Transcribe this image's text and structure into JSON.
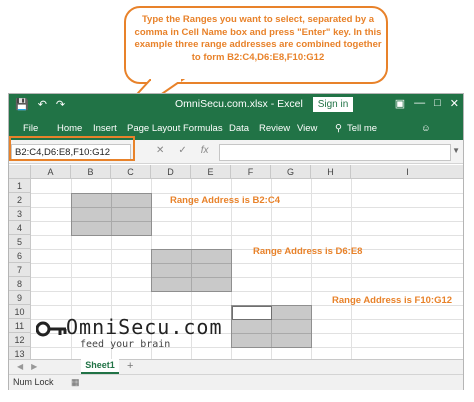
{
  "callout": {
    "text": "Type the Ranges you want to select, separated by a comma in Cell Name box and press \"Enter\" key. In this example three range addresses are combined together to form B2:C4,D6:E8,F10:G12"
  },
  "titlebar": {
    "title": "OmniSecu.com.xlsx - Excel",
    "sign_in": "Sign in",
    "save_icon": "save-icon",
    "undo_icon": "undo-icon",
    "redo_icon": "redo-icon",
    "restore_icon": "ribbon-display-icon",
    "minimize_icon": "minimize-icon",
    "maximize_icon": "maximize-icon",
    "close_icon": "close-icon"
  },
  "ribbon": {
    "tabs": [
      "File",
      "Home",
      "Insert",
      "Page Layout",
      "Formulas",
      "Data",
      "Review",
      "View",
      "Tell me"
    ],
    "help_icon": "lightbulb-icon",
    "share_icon": "share-icon"
  },
  "formula_bar": {
    "name_box": "B2:C4,D6:E8,F10:G12",
    "cancel_symbol": "✕",
    "enter_symbol": "✓",
    "fx_symbol": "fx",
    "formula": ""
  },
  "grid": {
    "columns": [
      "A",
      "B",
      "C",
      "D",
      "E",
      "F",
      "G",
      "H",
      "I"
    ],
    "rows": [
      "1",
      "2",
      "3",
      "4",
      "5",
      "6",
      "7",
      "8",
      "9",
      "10",
      "11",
      "12",
      "13"
    ]
  },
  "labels": {
    "range1": "Range Address is B2:C4",
    "range2": "Range Address is D6:E8",
    "range3": "Range Address is F10:G12"
  },
  "sheets": {
    "active": "Sheet1",
    "add": "+"
  },
  "status": {
    "text": "Num Lock"
  },
  "logo": {
    "text": "OmniSecu.com",
    "tagline": "feed your brain"
  },
  "colors": {
    "excel_green": "#217346",
    "annotation_orange": "#e8822a",
    "selection_gray": "#c9c9c9"
  }
}
